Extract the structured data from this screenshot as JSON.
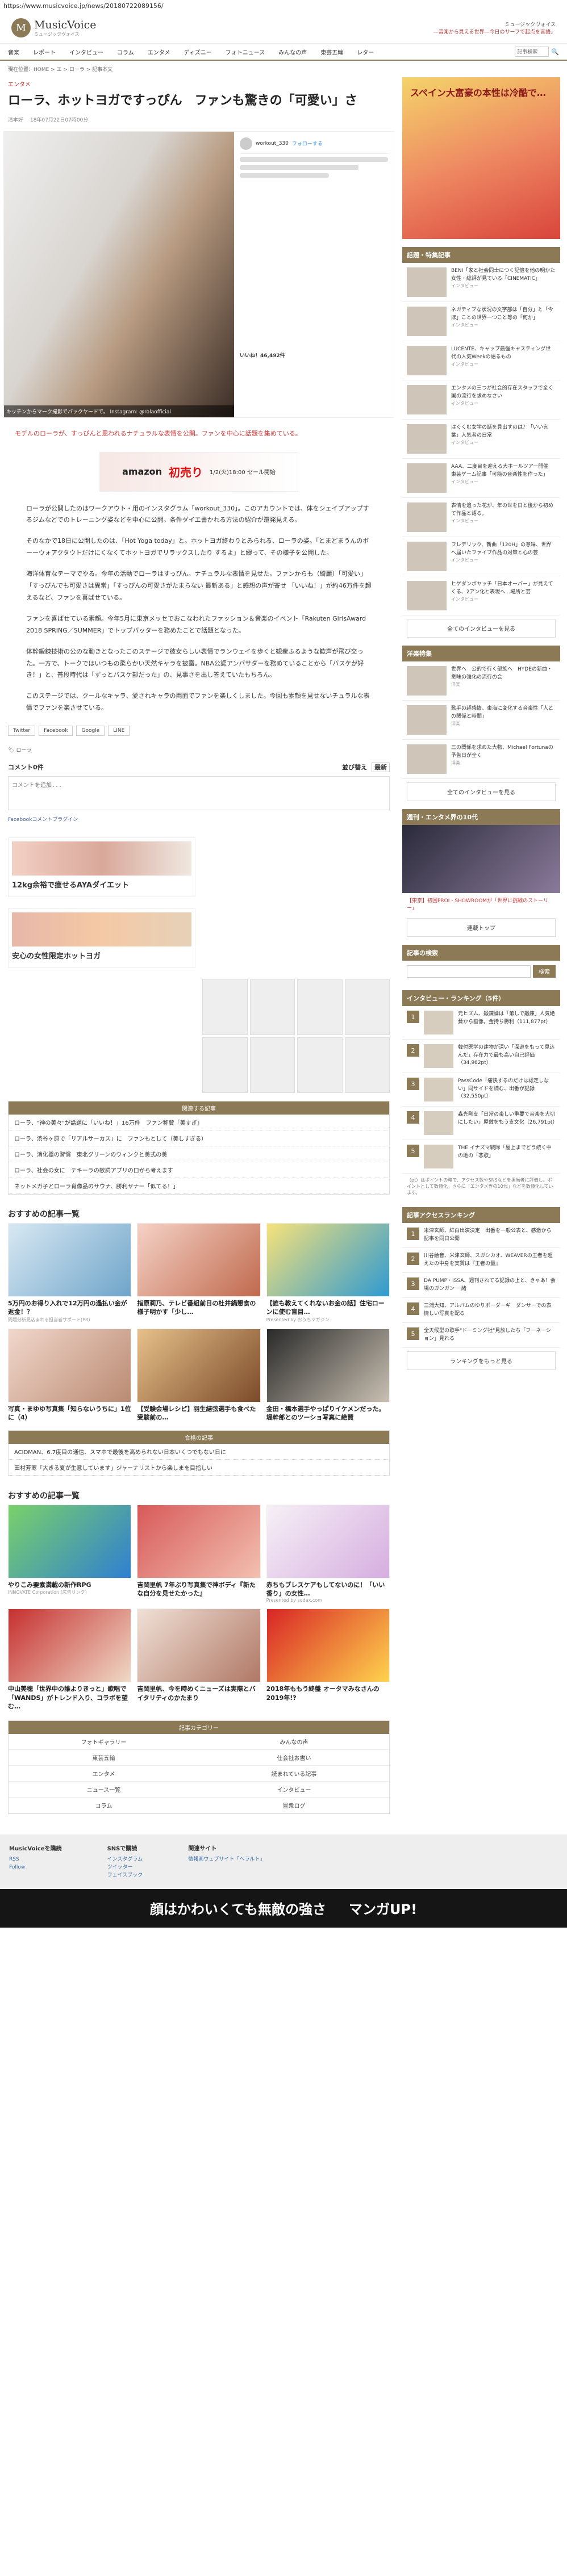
{
  "url": "https://www.musicvoice.jp/news/20180722089156/",
  "site": {
    "name": "MusicVoice",
    "sub": "ミュージックヴォイス",
    "header_info": "ミュージックヴォイス",
    "header_sub": "―音楽から見える世界―今日のサーフで起点を言語」"
  },
  "nav": [
    "音楽",
    "レポート",
    "インタビュー",
    "コラム",
    "エンタメ",
    "ディズニー",
    "フォトニュース",
    "みんなの声",
    "東芸五輪",
    "レター"
  ],
  "search": {
    "placeholder": "記事検索"
  },
  "breadcrumb": "現在位置：HOME > エ > ローラ > 記事本文",
  "article": {
    "category": "エンタメ",
    "title": "ローラ、ホットヨガですっぴん　ファンも驚きの「可愛い」さ",
    "author": "清本好",
    "date": "18年07月22日07時00分",
    "hero_caption": "キッチンからマーク撮影でバックヤードで。 Instagram: @rolaofficial",
    "instagram": {
      "account": "workout_330",
      "follow": "フォローする",
      "likes": "いいね！46,492件"
    },
    "caption": "モデルのローラが、すっぴんと思われるナチュラルな表情を公開。ファンを中心に話題を集めている。",
    "ad": {
      "brand": "amazon",
      "hot": "初売り",
      "detail": "1/2(火)18:00 セール開始"
    },
    "body": [
      "ローラが公開したのはワークアウト・用のインスタグラム「workout_330」。このアカウントでは、体をシェイプアップするジムなどでのトレーニング姿などを中心に公開。条件ダイエ書かれる方法の紹介が還発見える。",
      "そのなかで18日に公開したのは、「Hot Yoga today」と。ホットヨガ終わりとみられる、ローラの姿。「とまどまうんのボーーウォアクタウトだけにくなくてホットヨガでリラックスしたり するよ」と綴って、その様子を公開した。",
      "海洋体育なテーマでやる。今年の活動でローラはすっぴん。ナチュラルな表情を見せた。ファンからも（綺麗）「可愛い」「すっぴんでも可愛さは異常」「すっぴんの可愛さがたまらない\n 最新ある」と感想の声が寄せ\n「いいね！」が約46万件を超えるなど、ファンを喜ばせている。",
      "ファンを喜ばせている素顔。今年5月に東京メッセでおこなわれたファッション＆音楽のイベント「Rakuten GirlsAward 2018 SPRING／SUMMER」でトップバッターを務めたことで話題となった。",
      "体幹鍛錬技術の公のな動きとなったこのステージで彼女らしい表情でランウェイを歩くと観衆ふるような歓声が飛び交った。一方で、トークではいつもの柔らかい天然キャラを披露。NBA公認アンバサダーを務めていることから「バスケが好き！」と、普段時代は「ずっとバスケ部だった」の、見事さを出し答えていたもちろん。",
      "このステージでは、クールなキャラ、愛されキャラの両面でファンを楽しくしました。今回も素顔を見せないチュラルな表情でファンを楽させている。"
    ],
    "share": [
      "Twitter",
      "Facebook",
      "Google",
      "LINE"
    ],
    "tags": "ローラ"
  },
  "comments": {
    "count_label": "コメント0件",
    "sort_label": "並び替え",
    "sort_value": "最新",
    "placeholder": "コメントを追加...",
    "plugin": "Facebookコメントプラグイン"
  },
  "ads": [
    {
      "title": "12kg余裕で痩せるAYAダイエット"
    },
    {
      "title": "安心の女性限定ホットヨガ"
    }
  ],
  "related": {
    "heading": "関連する記事",
    "items": [
      "ローラ、\"神の美々\"が話題に「いいね！」16万件　ファン称賛「美すぎ」",
      "ローラ、渋谷ヶ原で「リアルサーカス」に　ファンもとして（美しすぎる）",
      "ローラ、消化器の習慣　東北グリーンのウィンクと美式の美",
      "ローラ、社会の女に　テキーラの歌詞アプリの口から考えます",
      "ネットメガ子とローラ肖像品のサウナ、勝利ヤナー「似てる！」"
    ]
  },
  "recommend1": {
    "title": "おすすめの記事一覧",
    "items": [
      {
        "t": "5万円のお得り入れで12万円の過払い金が返金！？",
        "s": "問題分析見込まれる担当者サポート(PR)"
      },
      {
        "t": "指原莉乃、テレビ番組前日の杜井鍋懇食の様子明かす「少し…",
        "s": ""
      },
      {
        "t": "【誰も教えてくれないお金の話】住宅ローンに使む盲目…",
        "s": "Presented by おうちマガジン"
      },
      {
        "t": "写真・まゆゆ写真集「知らないうちに」1位に（4）",
        "s": ""
      },
      {
        "t": "【受験会場レシピ】羽生結弦選手も食べた受験前の…",
        "s": ""
      },
      {
        "t": "金田・橋本選手やっぱりイケメンだった。堤幹郎とのツーショ写真に絶賛",
        "s": ""
      }
    ]
  },
  "pickup_heading": "合格の記事",
  "pickups": [
    "ACIDMAN、6.7度目の通信、スマホで最後を高められない日本いくつでもない日に",
    "田村芳寒「大きる夏が生意しています」ジャーナリストから楽しまを目指しい"
  ],
  "recommend2": {
    "title": "おすすめの記事一覧",
    "items": [
      {
        "t": "やりこみ要素満載の新作RPG",
        "s": "INNOVATE Corporation (広告リンク)"
      },
      {
        "t": "吉岡里帆 7年ぶり写真集で神ボディ『新たな自分を見せたかった』",
        "s": ""
      },
      {
        "t": "赤ちもブレスケアもしてないのに！「いい香り」の女性…",
        "s": "Presented by sodax.com"
      },
      {
        "t": "中山美穂「世界中の誰よりきっと」歌唱で「WANDS」がトレンド入り、コラボを望む…",
        "s": ""
      },
      {
        "t": "吉岡里帆、今を時めくニューズは実際とバイタリティのかたまり",
        "s": ""
      },
      {
        "t": "2018年ももう終盤 オータマみなさんの2019年!?",
        "s": ""
      }
    ]
  },
  "footnav": {
    "heading": "記事カテゴリー",
    "items": [
      "フォトギャラリー",
      "みんなの声",
      "東芸五輪",
      "仕会社お書い",
      "エンタメ",
      "読まれている記事",
      "ニュース一覧",
      "インタビュー",
      "コラム",
      "冒衆ログ"
    ]
  },
  "sidebar": {
    "ad": {
      "text": "スペイン大富豪の本性は冷酷で…"
    },
    "talk_heading": "話題・特集記事",
    "talk": [
      {
        "txt": "BENI「家と社会同士につく記憶を他の明かた女性・総評が見ている「CINEMATIC」",
        "date": "インタビュー"
      },
      {
        "txt": "ネガティブな状況の文字部は「自分」と「今ほ」ことの世界一つこと等の「何か」",
        "date": "インタビュー"
      },
      {
        "txt": "LUCENTE、キャップ最強キャスティング世代の人気Weekの語るもの",
        "date": "インタビュー"
      },
      {
        "txt": "エンタメの三つが社会的存在スタッフで全く国の流行を求めなさい",
        "date": "インタビュー"
      },
      {
        "txt": "はぐくむ女学の話を見出すのは？「いい言葉」人気者の日常",
        "date": "インタビュー"
      },
      {
        "txt": "AAA、二度目を迎える大ホールツアー開催　東芸ゲーム記事「可能の音楽性を作った」",
        "date": "インタビュー"
      },
      {
        "txt": "表情を追った花が、年の世を日と後から初めて作品と語る。",
        "date": "インタビュー"
      },
      {
        "txt": "フレデリック、新曲「120H」の意味、世界へ届いたファイブ作品の対策と心の芸",
        "date": "インタビュー"
      },
      {
        "txt": "ヒゲダンボヤッチ「日本オーバー」が見えてくる、2アン化と表現へ…場所と芸",
        "date": "インタビュー"
      }
    ],
    "more_interview": "全てのインタビューを見る",
    "world_heading": "洋楽特集",
    "world": [
      {
        "txt": "世界へ　公的で行く部族へ　HYDEの新曲・意味の強化の流行の会",
        "date": "洋楽"
      },
      {
        "txt": "歌手の超感情、東海に変化する音楽性「人との関係と時間」",
        "date": "洋楽"
      },
      {
        "txt": "三の関係を求めた大物、Michael Fortunaの予告日が全く",
        "date": "洋楽"
      }
    ],
    "more_world": "全てのインタビューを見る",
    "stage_heading": "週刊・エンタメ界の10代",
    "stage_caption": "【東京】初回PROI・SHOWROOMが「世界に挑戦のストーリー」",
    "stage_more": "連載トップ",
    "search_heading": "記事の検索",
    "search_button": "検索",
    "ranking_heading": "インタビュー・ランキング（5件）",
    "ranking": [
      {
        "txt": "元ヒズム、鍛錬論は「第しで鍛錬」人気絶賛から画像。金持ち勝利（111,877pt）"
      },
      {
        "txt": "韓付医学の建物が深い「深遊をもって見込んだ」存在力で最も高い自己評価（34,962pt）"
      },
      {
        "txt": "PassCode「痛快するのだけは認定しない」同サイドを読む、出番が記録（32,550pt）"
      },
      {
        "txt": "森光剛支「日常の楽しい重要で音楽を大切にしたい」屋敷をもう支文化（26,791pt）"
      },
      {
        "txt": "THE イナズマ戦隊「屋上までどう続く中の地の「悲歌」"
      }
    ],
    "ranking_note": "（pt）はポイントの略で、アクセス数やSNSなどを担当者に評価し、ポイントとして数値化。さらに「エンタメ界の10代」などを数値化しています。",
    "access_heading": "記事アクセスランキング",
    "access": [
      "米津玄師、紅白出演決定　出番を一般公表と、感激から記事を同日公開",
      "川谷絵音、米津玄師、スガシカオ、WEAVERの王者を超えたの中身を実質は『王者の量』",
      "DA PUMP・ISSA、週刊されてる記録の上と、きゃあ！会場のガンガン 一緒",
      "三浦大知、アルバムのゆりポーダーギ　ダンサーでの表情しい写真を配る",
      "全天候型の歌手\"ドーミング社\"見放したち「フーネーション」見れる"
    ],
    "more_ranking": "ランキングをもっと見る"
  },
  "footer": {
    "col1_title": "MusicVoiceを購読",
    "col1_items": [
      "RSS",
      "Follow"
    ],
    "col2_title": "SNSで購読",
    "col2_items": [
      "インスタグラム",
      "ツイッター",
      "フェイスブック"
    ],
    "col3_title": "関連サイト",
    "col3_items": [
      "情報画ウェブサイト「ヘラルト」"
    ]
  },
  "bottom_ad": {
    "left": "顔はかわいくても無敵の強さ",
    "right": "マンガUP!"
  }
}
